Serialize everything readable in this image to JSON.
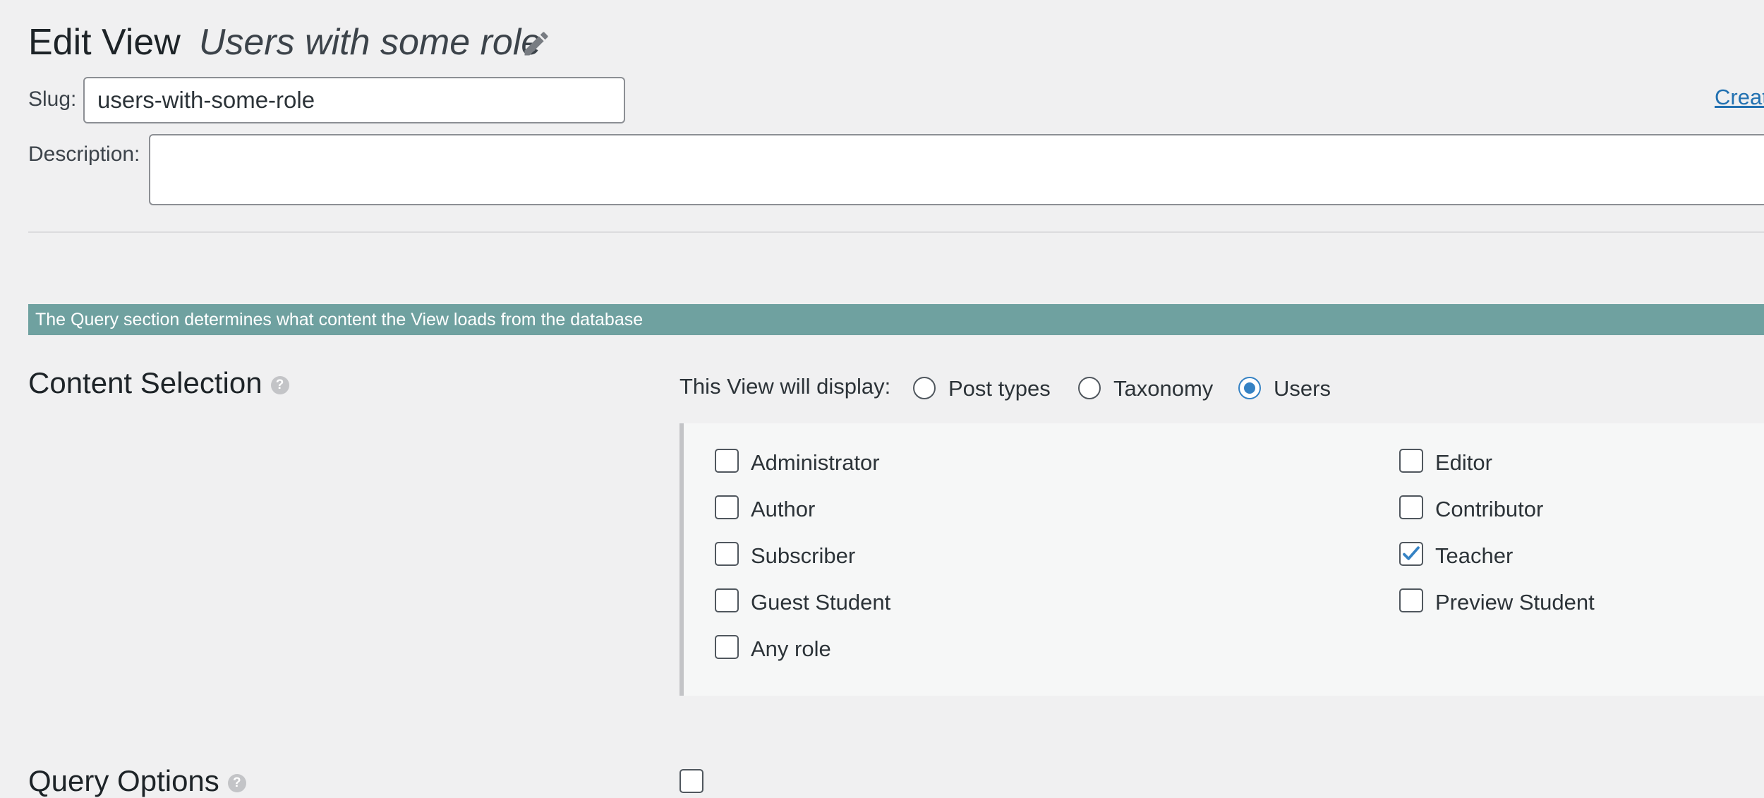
{
  "header": {
    "title": "Edit View",
    "view_name": "Users with some role"
  },
  "slug": {
    "label": "Slug:",
    "value": "users-with-some-role"
  },
  "create_link": "Creat",
  "description": {
    "label": "Description:",
    "value": ""
  },
  "query_info": "The Query section determines what content the View loads from the database",
  "content_selection": {
    "title": "Content Selection",
    "help": "?",
    "display_label": "This View will display:",
    "options": [
      {
        "label": "Post types",
        "checked": false
      },
      {
        "label": "Taxonomy",
        "checked": false
      },
      {
        "label": "Users",
        "checked": true
      }
    ],
    "roles": [
      {
        "label": "Administrator",
        "checked": false
      },
      {
        "label": "Editor",
        "checked": false
      },
      {
        "label": "Author",
        "checked": false
      },
      {
        "label": "Contributor",
        "checked": false
      },
      {
        "label": "Subscriber",
        "checked": false
      },
      {
        "label": "Teacher",
        "checked": true
      },
      {
        "label": "Guest Student",
        "checked": false
      },
      {
        "label": "Preview Student",
        "checked": false
      },
      {
        "label": "Any role",
        "checked": false
      }
    ]
  },
  "query_options": {
    "title": "Query Options",
    "help": "?"
  },
  "colors": {
    "info_bar": "#6fa1a0",
    "accent": "#3582c4",
    "link": "#2271b1"
  }
}
